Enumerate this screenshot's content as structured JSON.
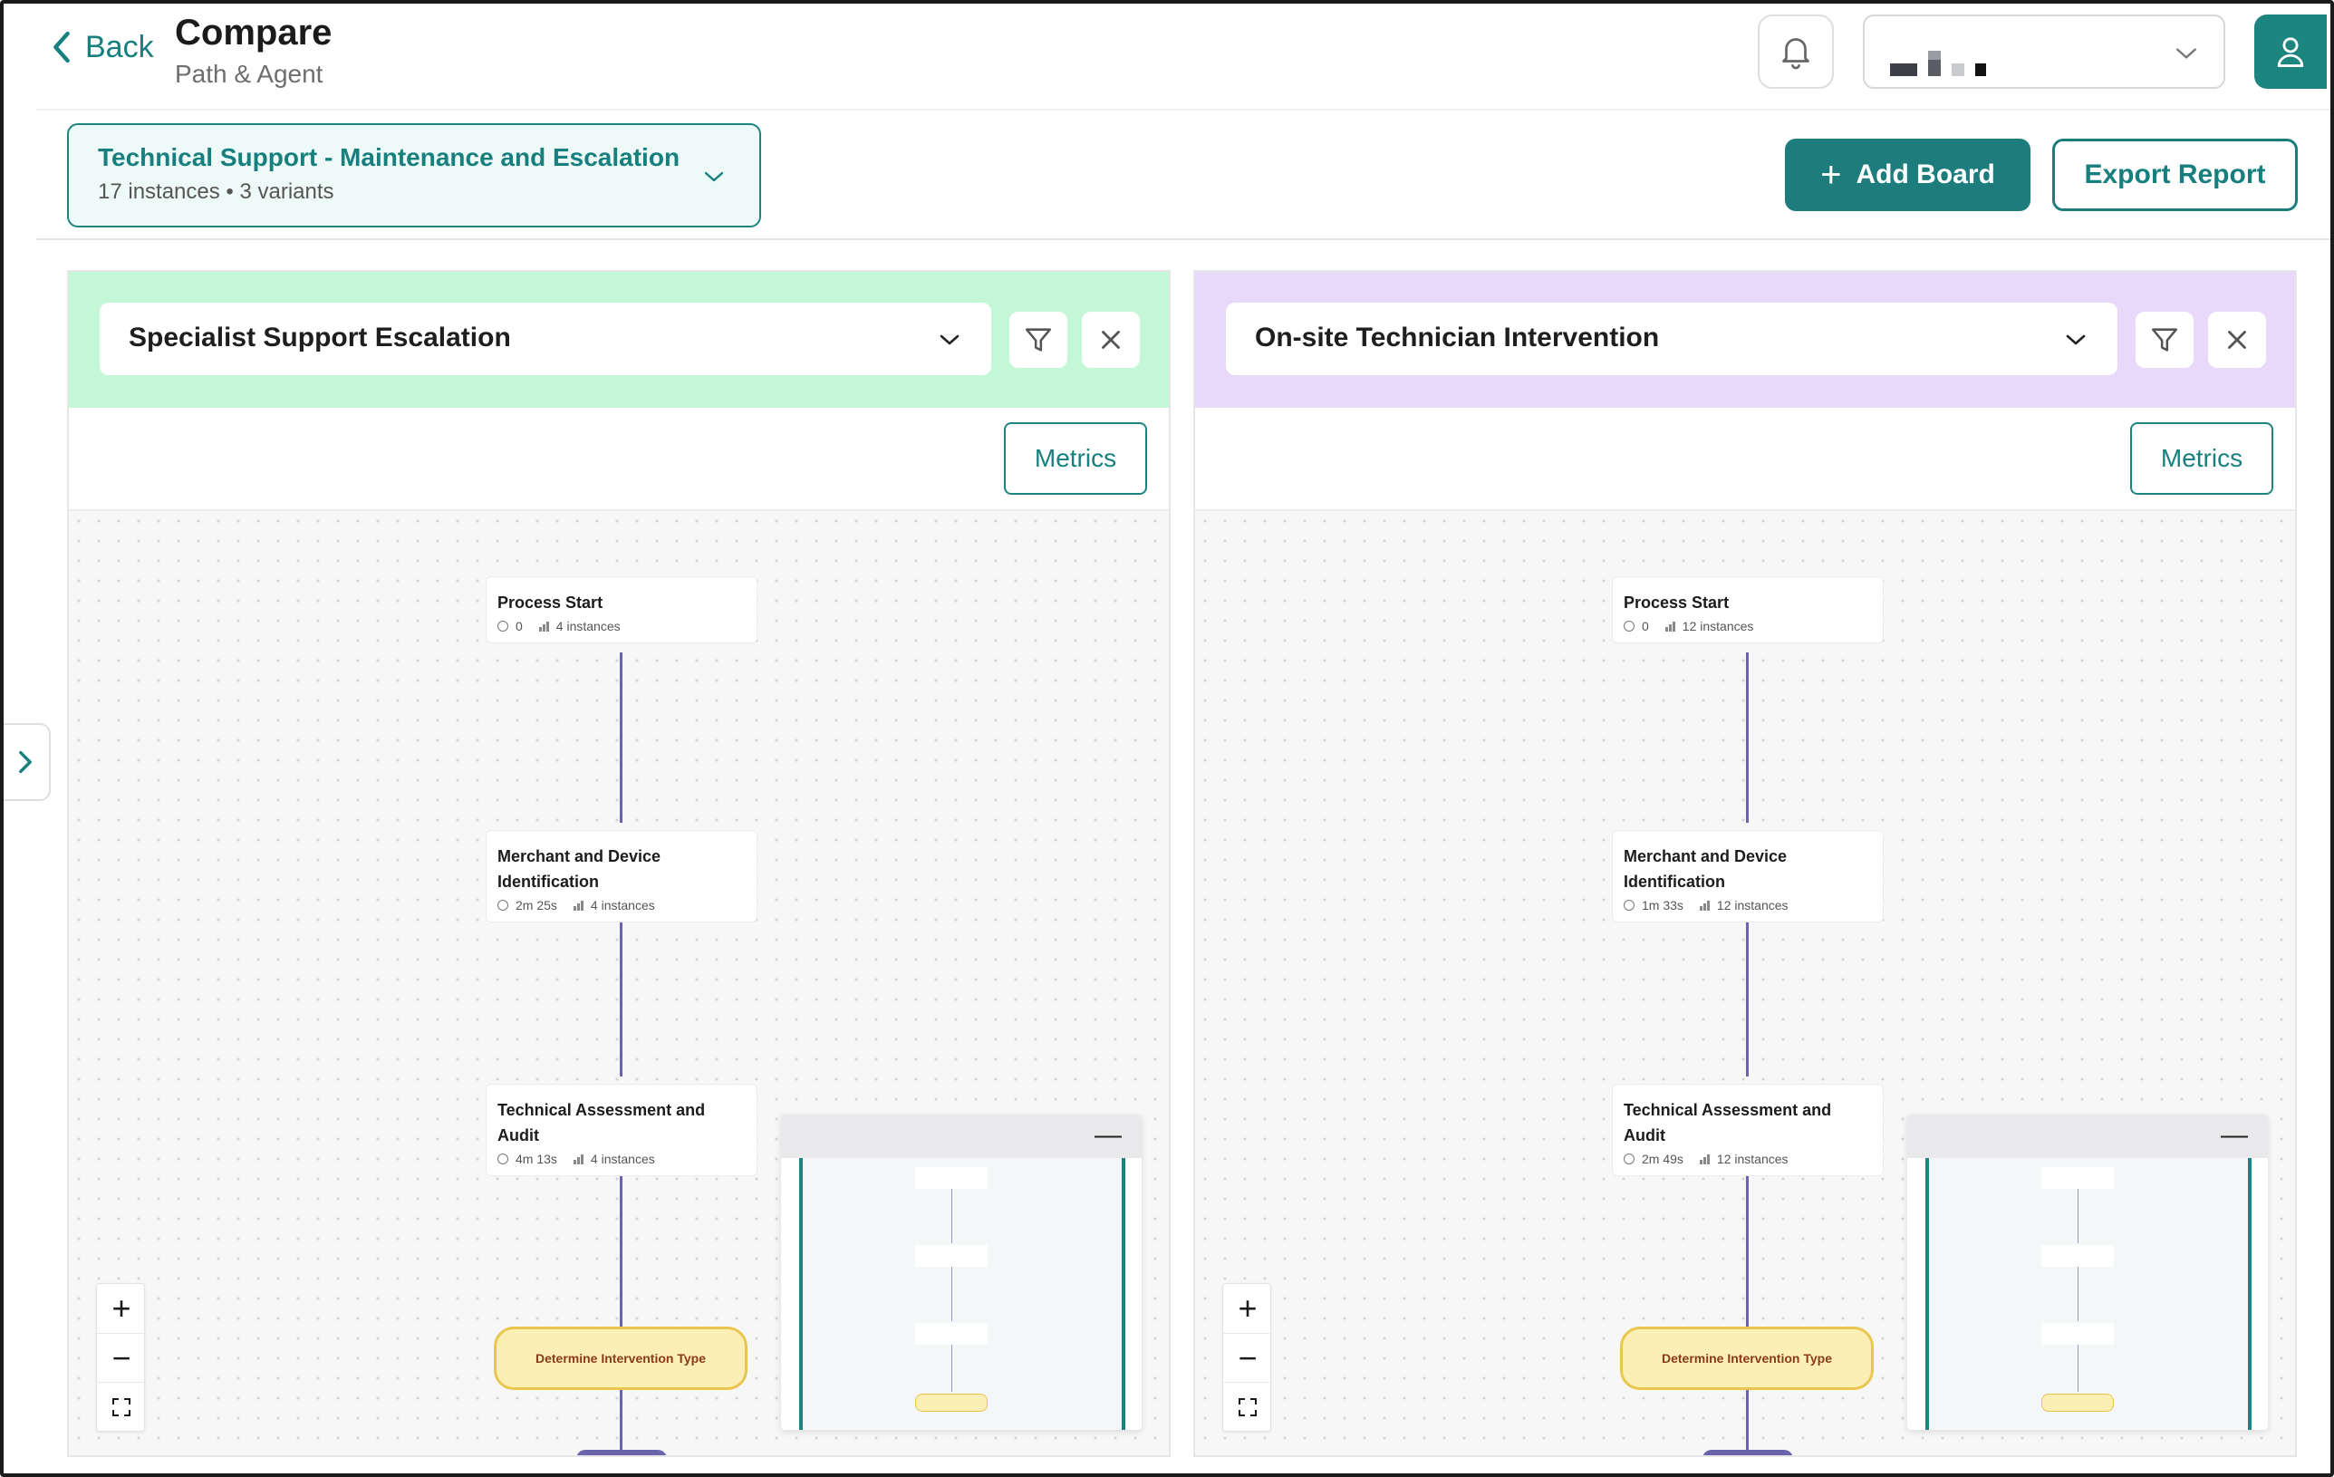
{
  "header": {
    "back_label": "Back",
    "title": "Compare",
    "subtitle": "Path & Agent"
  },
  "process": {
    "title": "Technical Support - Maintenance and Escalation",
    "meta": "17 instances • 3 variants"
  },
  "actions": {
    "add_board": "Add Board",
    "export_report": "Export Report"
  },
  "boards": [
    {
      "variant": "Specialist Support Escalation",
      "header_color": "#c4f7d8",
      "metrics_label": "Metrics",
      "nodes": [
        {
          "title": "Process Start",
          "duration": "0",
          "instances": "4 instances"
        },
        {
          "title": "Merchant and Device Identification",
          "duration": "2m 25s",
          "instances": "4 instances"
        },
        {
          "title": "Technical Assessment and Audit",
          "duration": "4m 13s",
          "instances": "4 instances"
        }
      ],
      "decision": "Determine Intervention Type"
    },
    {
      "variant": "On-site Technician Intervention",
      "header_color": "#e8d9fb",
      "metrics_label": "Metrics",
      "nodes": [
        {
          "title": "Process Start",
          "duration": "0",
          "instances": "12 instances"
        },
        {
          "title": "Merchant and Device Identification",
          "duration": "1m 33s",
          "instances": "12 instances"
        },
        {
          "title": "Technical Assessment and Audit",
          "duration": "2m 49s",
          "instances": "12 instances"
        }
      ],
      "decision": "Determine Intervention Type"
    }
  ],
  "colors": {
    "accent": "#1d8580",
    "edge": "#6a64ad",
    "decision_fill": "#fcefb6",
    "decision_border": "#e9c64e"
  }
}
